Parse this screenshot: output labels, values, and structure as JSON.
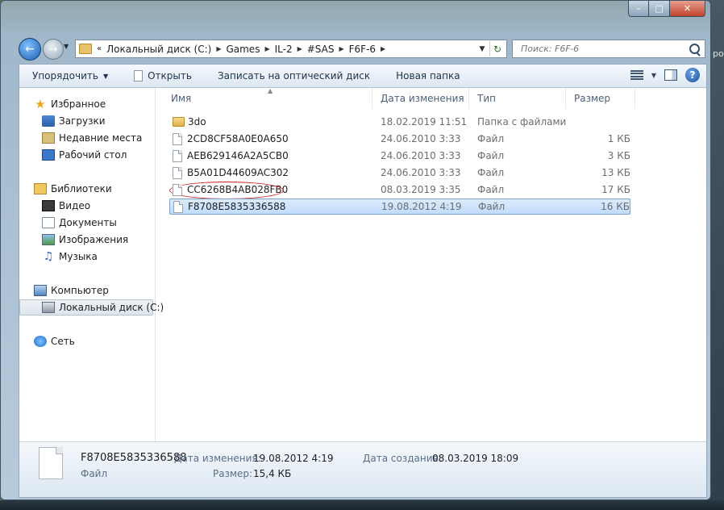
{
  "window": {
    "caption": {
      "minimize": "–",
      "maximize": "□",
      "close": "✕"
    }
  },
  "navigation": {
    "back_icon": "back-arrow-icon",
    "forward_icon": "forward-arrow-icon",
    "breadcrumb": [
      "Локальный диск (C:)",
      "Games",
      "IL-2",
      "#SAS",
      "F6F-6"
    ],
    "search_placeholder": "Поиск: F6F-6"
  },
  "toolbar": {
    "organize": "Упорядочить",
    "open": "Открыть",
    "burn": "Записать на оптический диск",
    "new_folder": "Новая папка"
  },
  "sidebar": {
    "favorites": "Избранное",
    "downloads": "Загрузки",
    "recent": "Недавние места",
    "desktop": "Рабочий стол",
    "libraries": "Библиотеки",
    "video": "Видео",
    "documents": "Документы",
    "images": "Изображения",
    "music": "Музыка",
    "computer": "Компьютер",
    "local_disk": "Локальный диск (C:)",
    "network": "Сеть"
  },
  "columns": {
    "name": "Имя",
    "date": "Дата изменения",
    "type": "Тип",
    "size": "Размер"
  },
  "files": [
    {
      "name": "3do",
      "date": "18.02.2019 11:51",
      "type": "Папка с файлами",
      "size": ""
    },
    {
      "name": "2CD8CF58A0E0A650",
      "date": "24.06.2010 3:33",
      "type": "Файл",
      "size": "1 КБ"
    },
    {
      "name": "AEB629146A2A5CB0",
      "date": "24.06.2010 3:33",
      "type": "Файл",
      "size": "3 КБ"
    },
    {
      "name": "B5A01D44609AC302",
      "date": "24.06.2010 3:33",
      "type": "Файл",
      "size": "13 КБ"
    },
    {
      "name": "CC6268B4AB028FB0",
      "date": "08.03.2019 3:35",
      "type": "Файл",
      "size": "17 КБ"
    },
    {
      "name": "F8708E5835336588",
      "date": "19.08.2012 4:19",
      "type": "Файл",
      "size": "16 КБ"
    }
  ],
  "details": {
    "filename": "F8708E5835336588",
    "filetype": "Файл",
    "modified_label": "Дата изменения:",
    "modified_value": "19.08.2012 4:19",
    "created_label": "Дата создания:",
    "created_value": "08.03.2019 18:09",
    "size_label": "Размер:",
    "size_value": "15,4 КБ"
  },
  "desktop_edge_text": "ро"
}
